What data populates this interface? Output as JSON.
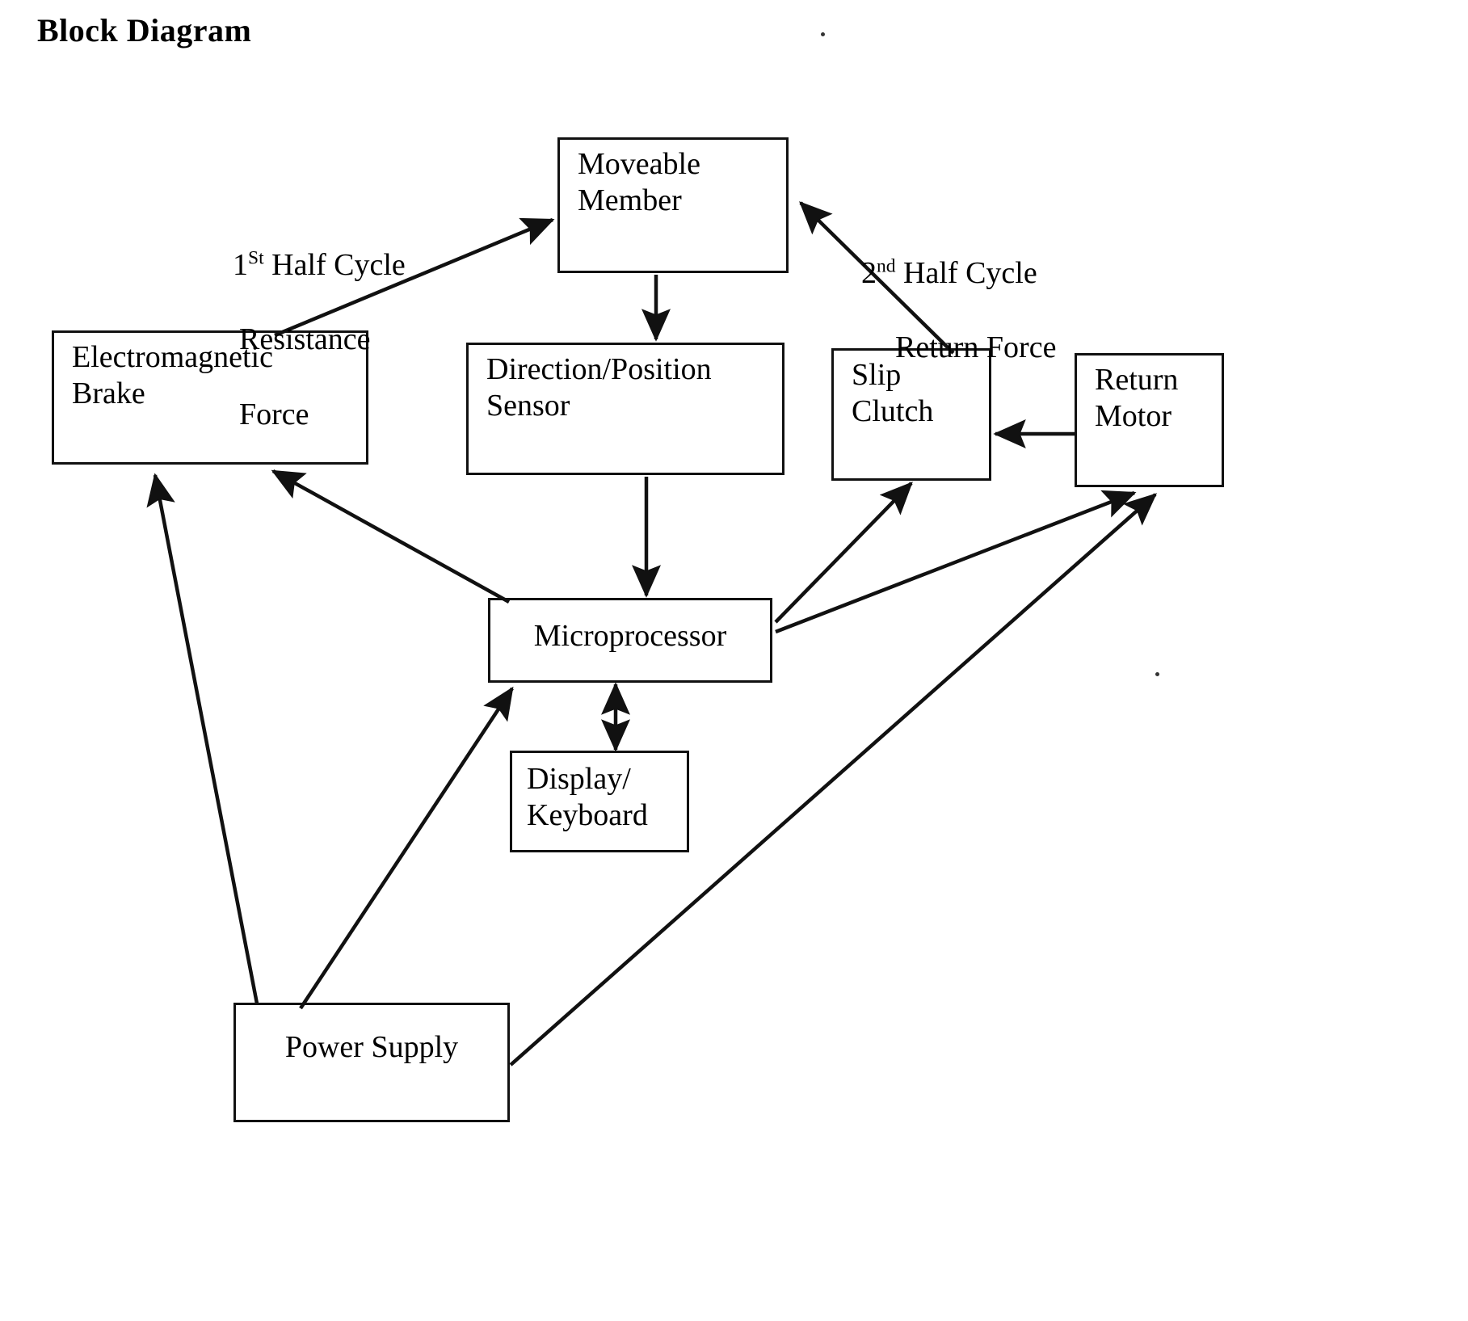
{
  "title": "Block Diagram",
  "diagram": {
    "type": "block-diagram",
    "nodes": [
      {
        "id": "moveable-member",
        "label": "Moveable\nMember"
      },
      {
        "id": "electromagnetic-brake",
        "label": "Electromagnetic\nBrake"
      },
      {
        "id": "direction-position-sensor",
        "label": "Direction/Position\nSensor"
      },
      {
        "id": "slip-clutch",
        "label": "Slip\nClutch"
      },
      {
        "id": "return-motor",
        "label": "Return\nMotor"
      },
      {
        "id": "microprocessor",
        "label": "Microprocessor"
      },
      {
        "id": "display-keyboard",
        "label": "Display/\nKeyboard"
      },
      {
        "id": "power-supply",
        "label": "Power Supply"
      }
    ],
    "annotations": [
      {
        "id": "first-half-cycle",
        "line1_prefix": "1",
        "line1_sup": "St",
        "line1_rest": " Half Cycle",
        "line2": "Resistance",
        "line3": "Force"
      },
      {
        "id": "second-half-cycle",
        "line1_prefix": "2",
        "line1_sup": "nd",
        "line1_rest": " Half Cycle",
        "line2": "Return Force",
        "line3": ""
      }
    ],
    "edges": [
      {
        "from": "electromagnetic-brake",
        "to": "moveable-member",
        "arrow": "single",
        "note": "1St Half Cycle Resistance Force"
      },
      {
        "from": "return-motor",
        "to": "moveable-member",
        "arrow": "single",
        "note": "2nd Half Cycle Return Force"
      },
      {
        "from": "moveable-member",
        "to": "direction-position-sensor",
        "arrow": "single"
      },
      {
        "from": "direction-position-sensor",
        "to": "microprocessor",
        "arrow": "single"
      },
      {
        "from": "microprocessor",
        "to": "electromagnetic-brake",
        "arrow": "single"
      },
      {
        "from": "microprocessor",
        "to": "slip-clutch",
        "arrow": "single"
      },
      {
        "from": "microprocessor",
        "to": "return-motor",
        "arrow": "single"
      },
      {
        "from": "microprocessor",
        "to": "display-keyboard",
        "arrow": "double"
      },
      {
        "from": "return-motor",
        "to": "slip-clutch",
        "arrow": "single"
      },
      {
        "from": "power-supply",
        "to": "electromagnetic-brake",
        "arrow": "single"
      },
      {
        "from": "power-supply",
        "to": "microprocessor",
        "arrow": "single"
      },
      {
        "from": "power-supply",
        "to": "return-motor",
        "arrow": "single"
      }
    ],
    "colors": {
      "stroke": "#111111",
      "text": "#000000",
      "background": "#ffffff"
    }
  }
}
